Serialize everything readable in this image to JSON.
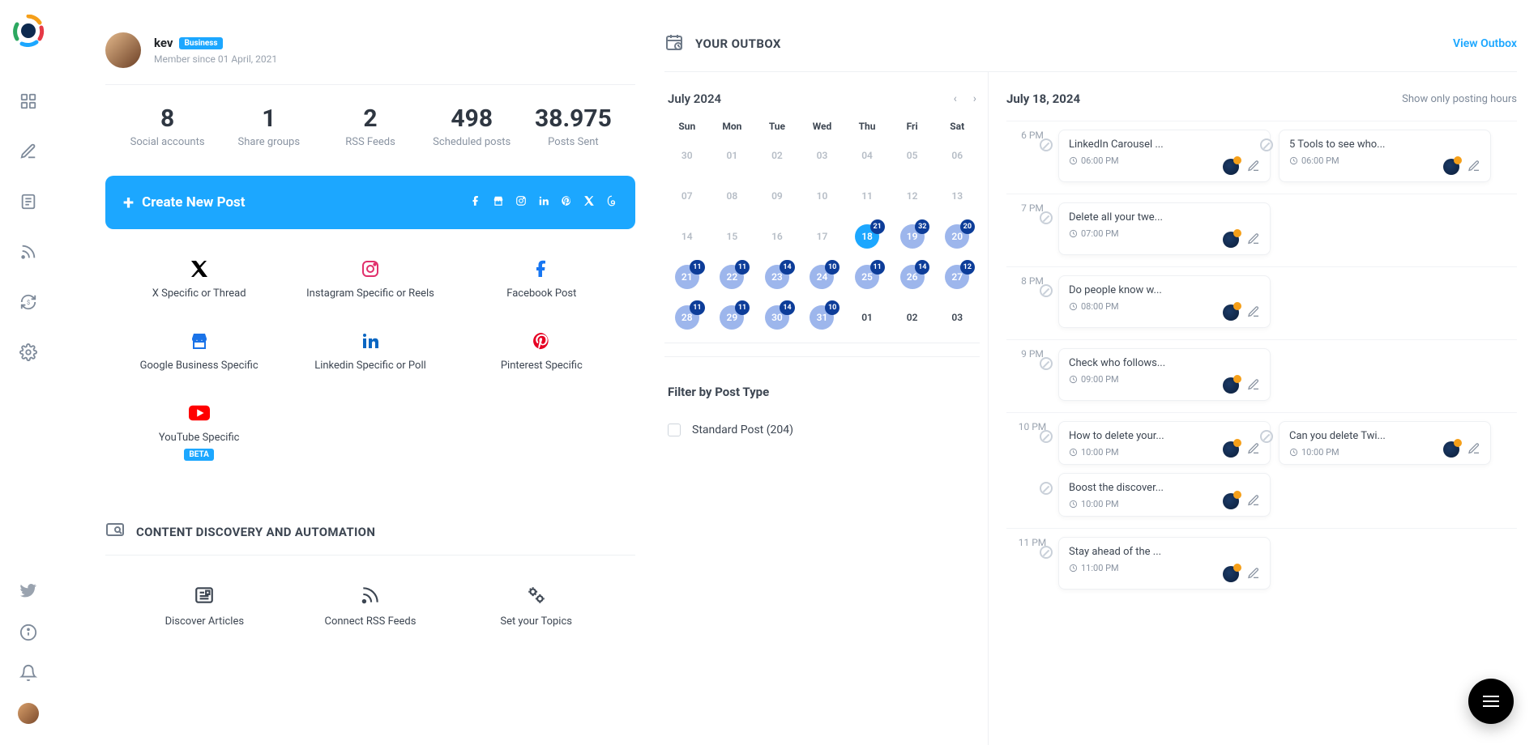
{
  "user": {
    "name": "kev",
    "plan": "Business",
    "member_since": "Member since 01 April, 2021"
  },
  "stats": [
    {
      "value": "8",
      "label": "Social accounts"
    },
    {
      "value": "1",
      "label": "Share groups"
    },
    {
      "value": "2",
      "label": "RSS Feeds"
    },
    {
      "value": "498",
      "label": "Scheduled posts"
    },
    {
      "value": "38.975",
      "label": "Posts Sent"
    }
  ],
  "create_button": "Create New Post",
  "post_types": [
    {
      "label": "X Specific or Thread",
      "icon": "x",
      "color": "c-x"
    },
    {
      "label": "Instagram Specific or Reels",
      "icon": "ig",
      "color": "c-ig"
    },
    {
      "label": "Facebook Post",
      "icon": "fb",
      "color": "c-fb"
    },
    {
      "label": "Google Business Specific",
      "icon": "gmb",
      "color": "c-gmb"
    },
    {
      "label": "Linkedin Specific or Poll",
      "icon": "li",
      "color": "c-li"
    },
    {
      "label": "Pinterest Specific",
      "icon": "pin",
      "color": "c-pin"
    },
    {
      "label": "YouTube Specific",
      "icon": "yt",
      "color": "c-yt",
      "beta": "BETA"
    }
  ],
  "content_discovery": {
    "title": "CONTENT DISCOVERY AND AUTOMATION",
    "items": [
      {
        "label": "Discover Articles",
        "icon": "news"
      },
      {
        "label": "Connect RSS Feeds",
        "icon": "rss"
      },
      {
        "label": "Set your Topics",
        "icon": "gears"
      }
    ]
  },
  "outbox": {
    "title": "YOUR OUTBOX",
    "view_link": "View Outbox",
    "month": "July 2024",
    "sel_date": "July 18, 2024",
    "show_posting": "Show only posting hours",
    "dows": [
      "Sun",
      "Mon",
      "Tue",
      "Wed",
      "Thu",
      "Fri",
      "Sat"
    ],
    "days": [
      {
        "n": "30",
        "cls": "dim"
      },
      {
        "n": "01",
        "cls": "dim"
      },
      {
        "n": "02",
        "cls": "dim"
      },
      {
        "n": "03",
        "cls": "dim"
      },
      {
        "n": "04",
        "cls": "dim"
      },
      {
        "n": "05",
        "cls": "dim"
      },
      {
        "n": "06",
        "cls": "dim"
      },
      {
        "n": "07",
        "cls": "dim"
      },
      {
        "n": "08",
        "cls": "dim"
      },
      {
        "n": "09",
        "cls": "dim"
      },
      {
        "n": "10",
        "cls": "dim"
      },
      {
        "n": "11",
        "cls": "dim"
      },
      {
        "n": "12",
        "cls": "dim"
      },
      {
        "n": "13",
        "cls": "dim"
      },
      {
        "n": "14",
        "cls": "dim"
      },
      {
        "n": "15",
        "cls": "dim"
      },
      {
        "n": "16",
        "cls": "dim"
      },
      {
        "n": "17",
        "cls": "dim"
      },
      {
        "n": "18",
        "cls": "today",
        "b": "21"
      },
      {
        "n": "19",
        "cls": "has",
        "b": "32"
      },
      {
        "n": "20",
        "cls": "has",
        "b": "20"
      },
      {
        "n": "21",
        "cls": "has",
        "b": "11"
      },
      {
        "n": "22",
        "cls": "has",
        "b": "11"
      },
      {
        "n": "23",
        "cls": "has",
        "b": "14"
      },
      {
        "n": "24",
        "cls": "has",
        "b": "10"
      },
      {
        "n": "25",
        "cls": "has",
        "b": "11"
      },
      {
        "n": "26",
        "cls": "has",
        "b": "14"
      },
      {
        "n": "27",
        "cls": "has",
        "b": "12"
      },
      {
        "n": "28",
        "cls": "has",
        "b": "11"
      },
      {
        "n": "29",
        "cls": "has",
        "b": "11"
      },
      {
        "n": "30",
        "cls": "has",
        "b": "14"
      },
      {
        "n": "31",
        "cls": "has",
        "b": "10"
      },
      {
        "n": "01",
        "cls": "norm"
      },
      {
        "n": "02",
        "cls": "norm"
      },
      {
        "n": "03",
        "cls": "norm"
      }
    ],
    "filter_title": "Filter by Post Type",
    "filters": [
      {
        "label": "Standard Post (204)"
      }
    ],
    "hours": [
      {
        "label": "6 PM",
        "cards": [
          {
            "title": "LinkedIn Carousel ...",
            "time": "06:00 PM"
          },
          {
            "title": "5 Tools to see who...",
            "time": "06:00 PM"
          }
        ]
      },
      {
        "label": "7 PM",
        "cards": [
          {
            "title": "Delete all your twe...",
            "time": "07:00 PM"
          }
        ]
      },
      {
        "label": "8 PM",
        "cards": [
          {
            "title": "Do people know w...",
            "time": "08:00 PM"
          }
        ]
      },
      {
        "label": "9 PM",
        "cards": [
          {
            "title": "Check who follows...",
            "time": "09:00 PM"
          }
        ]
      },
      {
        "label": "10 PM",
        "cards": [
          {
            "title": "How to delete your...",
            "time": "10:00 PM"
          },
          {
            "title": "Can you delete Twi...",
            "time": "10:00 PM"
          },
          {
            "title": "Boost the discover...",
            "time": "10:00 PM"
          }
        ]
      },
      {
        "label": "11 PM",
        "cards": [
          {
            "title": "Stay ahead of the ...",
            "time": "11:00 PM"
          }
        ]
      }
    ]
  }
}
